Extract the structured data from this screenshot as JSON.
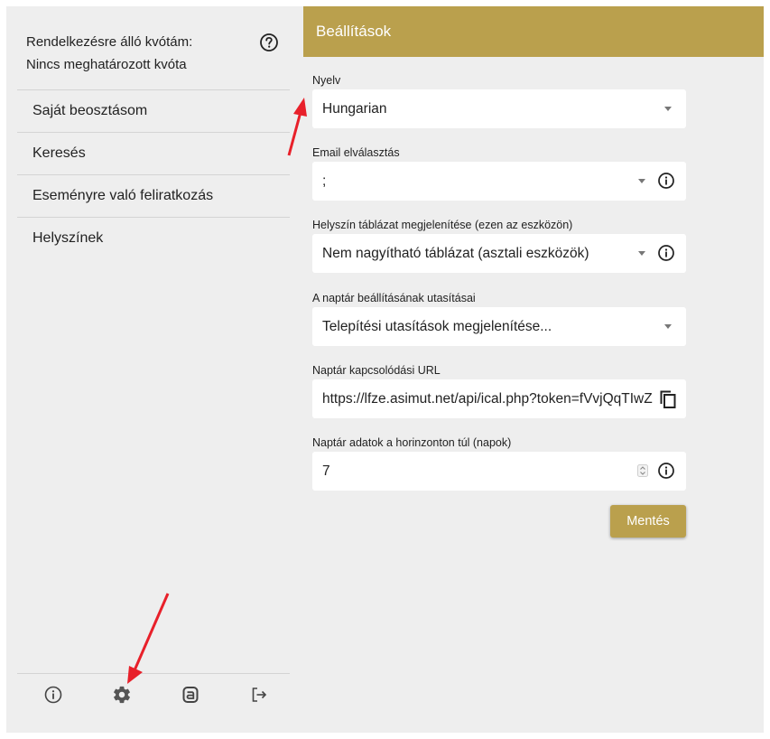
{
  "sidebar": {
    "quota_label": "Rendelkezésre álló kvótám:",
    "quota_value": "Nincs meghatározott kvóta",
    "help_icon": "help-circle-icon",
    "items": [
      {
        "label": "Saját beosztásom"
      },
      {
        "label": "Keresés"
      },
      {
        "label": "Eseményre való feliratkozás"
      },
      {
        "label": "Helyszínek"
      }
    ],
    "bottom_icons": [
      "info-icon",
      "gear-icon",
      "asimut-logo-icon",
      "logout-icon"
    ]
  },
  "header": {
    "title": "Beállítások"
  },
  "settings": {
    "language": {
      "label": "Nyelv",
      "value": "Hungarian"
    },
    "email_separator": {
      "label": "Email elválasztás",
      "value": ";"
    },
    "location_table": {
      "label": "Helyszín táblázat megjelenítése (ezen az eszközön)",
      "value": "Nem nagyítható táblázat (asztali eszközök)"
    },
    "calendar_instructions": {
      "label": "A naptár beállításának utasításai",
      "value": "Telepítési utasítások megjelenítése..."
    },
    "calendar_url": {
      "label": "Naptár kapcsolódási URL",
      "value": "https://lfze.asimut.net/api/ical.php?token=fVvjQqTIwZ"
    },
    "calendar_horizon": {
      "label": "Naptár adatok a horinzonton túl (napok)",
      "value": "7"
    },
    "save_label": "Mentés"
  },
  "colors": {
    "accent": "#baa04d",
    "background": "#eeeeee",
    "annotation_arrow": "#e8202a"
  }
}
